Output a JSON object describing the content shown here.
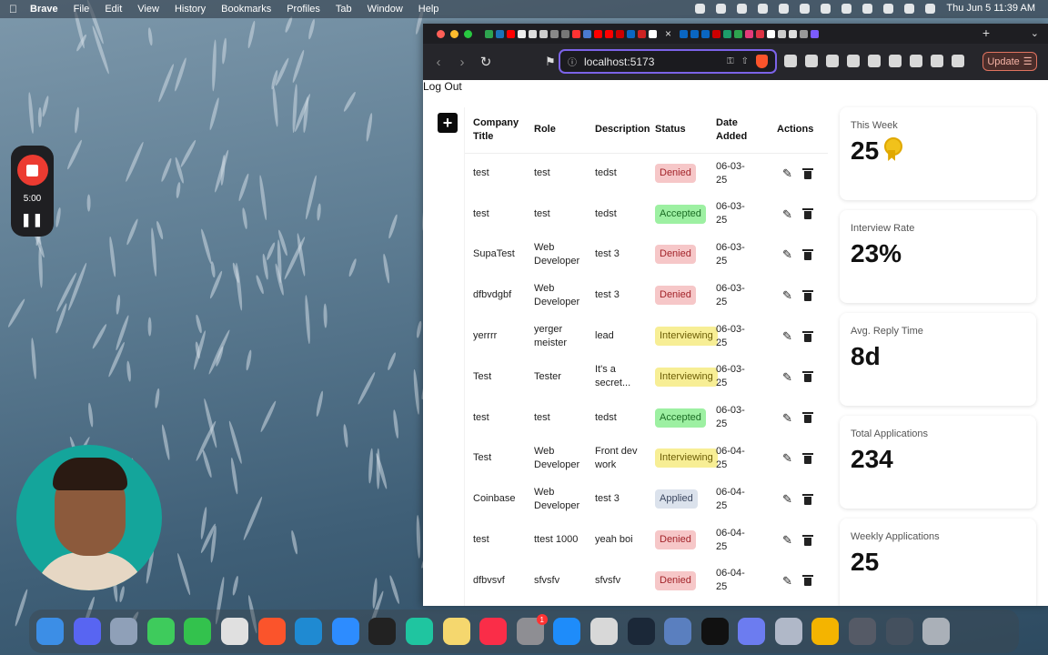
{
  "menubar": {
    "app_name": "Brave",
    "items": [
      "File",
      "Edit",
      "View",
      "History",
      "Bookmarks",
      "Profiles",
      "Tab",
      "Window",
      "Help"
    ],
    "clock": "Thu Jun 5  11:39 AM"
  },
  "recorder": {
    "time": "5:00"
  },
  "browser": {
    "url": "localhost:5173",
    "update_label": "Update"
  },
  "page": {
    "logout_label": "Log Out",
    "add_label": "+",
    "table": {
      "headers": [
        "Company Title",
        "Role",
        "Description",
        "Status",
        "Date Added",
        "Actions"
      ],
      "rows": [
        {
          "company": "test",
          "role": "test",
          "description": "tedst",
          "status": "Denied",
          "date": "06-03-25"
        },
        {
          "company": "test",
          "role": "test",
          "description": "tedst",
          "status": "Accepted",
          "date": "06-03-25"
        },
        {
          "company": "SupaTest",
          "role": "Web Developer",
          "description": "test 3",
          "status": "Denied",
          "date": "06-03-25"
        },
        {
          "company": "dfbvdgbf",
          "role": "Web Developer",
          "description": "test 3",
          "status": "Denied",
          "date": "06-03-25"
        },
        {
          "company": "yerrrr",
          "role": "yerger meister",
          "description": "lead",
          "status": "Interviewing",
          "date": "06-03-25"
        },
        {
          "company": "Test",
          "role": "Tester",
          "description": "It's a secret...",
          "status": "Interviewing",
          "date": "06-03-25"
        },
        {
          "company": "test",
          "role": "test",
          "description": "tedst",
          "status": "Accepted",
          "date": "06-03-25"
        },
        {
          "company": "Test",
          "role": "Web Developer",
          "description": "Front dev work",
          "status": "Interviewing",
          "date": "06-04-25"
        },
        {
          "company": "Coinbase",
          "role": "Web Developer",
          "description": "test 3",
          "status": "Applied",
          "date": "06-04-25"
        },
        {
          "company": "test",
          "role": "ttest 1000",
          "description": "yeah boi",
          "status": "Denied",
          "date": "06-04-25"
        },
        {
          "company": "dfbvsvf",
          "role": "sfvsfv",
          "description": "sfvsfv",
          "status": "Denied",
          "date": "06-04-25"
        }
      ]
    },
    "stats": [
      {
        "label": "This Week",
        "value": "25",
        "icon": "medal-icon"
      },
      {
        "label": "Interview Rate",
        "value": "23%"
      },
      {
        "label": "Avg. Reply Time",
        "value": "8d"
      },
      {
        "label": "Total Applications",
        "value": "234"
      },
      {
        "label": "Weekly Applications",
        "value": "25"
      }
    ]
  },
  "dock": {
    "badge_count": "1",
    "apps": [
      "finder",
      "discord",
      "launchpad",
      "messages",
      "facetime",
      "slack",
      "brave",
      "vscode",
      "zoom",
      "terminal",
      "app",
      "notes",
      "music",
      "system-settings",
      "app-store",
      "app",
      "steam",
      "app",
      "app",
      "app",
      "app",
      "chrome",
      "app",
      "app",
      "trash"
    ]
  },
  "colors": {
    "accent": "#7c63e8",
    "denied_bg": "#f6c7c8",
    "accepted_bg": "#9df0a2",
    "interviewing_bg": "#f7ee95",
    "applied_bg": "#dbe2ec"
  }
}
